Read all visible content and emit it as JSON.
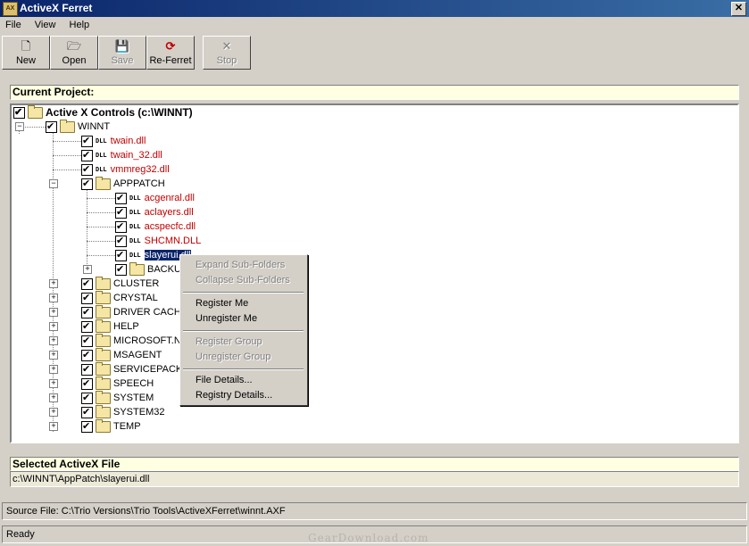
{
  "window": {
    "title": "ActiveX Ferret",
    "icon": "ferret-app-icon",
    "close_glyph": "✕"
  },
  "menu": [
    "File",
    "View",
    "Help"
  ],
  "toolbar": [
    {
      "label": "New",
      "icon": "new-document-icon",
      "glyph": "🗋",
      "enabled": true
    },
    {
      "label": "Open",
      "icon": "open-folder-icon",
      "glyph": "🗁",
      "enabled": true
    },
    {
      "label": "Save",
      "icon": "save-disk-icon",
      "glyph": "💾",
      "enabled": false
    },
    {
      "label": "Re-Ferret",
      "icon": "re-ferret-icon",
      "glyph": "⟳",
      "enabled": true
    },
    {
      "label": "Stop",
      "icon": "stop-x-icon",
      "glyph": "✕",
      "enabled": false
    }
  ],
  "project": {
    "label": "Current Project:"
  },
  "tree": {
    "root": "Active X Controls (c:\\WINNT)",
    "winnt": "WINNT",
    "items": [
      {
        "label": "twain.dll",
        "type": "dll"
      },
      {
        "label": "twain_32.dll",
        "type": "dll"
      },
      {
        "label": "vmmreg32.dll",
        "type": "dll"
      },
      {
        "label": "APPPATCH",
        "type": "folder"
      },
      {
        "label": "acgenral.dll",
        "type": "dll"
      },
      {
        "label": "aclayers.dll",
        "type": "dll"
      },
      {
        "label": "acspecfc.dll",
        "type": "dll"
      },
      {
        "label": "SHCMN.DLL",
        "type": "dll"
      },
      {
        "label": "slayerui.dll",
        "type": "dll"
      },
      {
        "label": "BACKU",
        "type": "folder"
      },
      {
        "label": "CLUSTER",
        "type": "folder"
      },
      {
        "label": "CRYSTAL",
        "type": "folder"
      },
      {
        "label": "DRIVER CACH",
        "type": "folder"
      },
      {
        "label": "HELP",
        "type": "folder"
      },
      {
        "label": "MICROSOFT.N",
        "type": "folder"
      },
      {
        "label": "MSAGENT",
        "type": "folder"
      },
      {
        "label": "SERVICEPACK",
        "type": "folder"
      },
      {
        "label": "SPEECH",
        "type": "folder"
      },
      {
        "label": "SYSTEM",
        "type": "folder"
      },
      {
        "label": "SYSTEM32",
        "type": "folder"
      },
      {
        "label": "TEMP",
        "type": "folder"
      }
    ],
    "dll_icon_text": "DLL",
    "expand_glyph": "+",
    "collapse_glyph": "−"
  },
  "context_menu": {
    "expand_sub": "Expand Sub-Folders",
    "collapse_sub": "Collapse Sub-Folders",
    "register_me": "Register Me",
    "unregister_me": "Unregister Me",
    "register_group": "Register Group",
    "unregister_group": "Unregister Group",
    "file_details": "File Details...",
    "registry_details": "Registry Details..."
  },
  "selected": {
    "label": "Selected ActiveX File",
    "path": "c:\\WINNT\\AppPatch\\slayerui.dll"
  },
  "status": {
    "source": "Source File: C:\\Trio Versions\\Trio Tools\\ActiveXFerret\\winnt.AXF",
    "ready": "Ready"
  },
  "watermark": "GearDownload.com",
  "colors": {
    "title_start": "#0a246a",
    "title_end": "#3a6ea5",
    "dll_text": "#c00000",
    "highlight": "#ffffe1"
  }
}
